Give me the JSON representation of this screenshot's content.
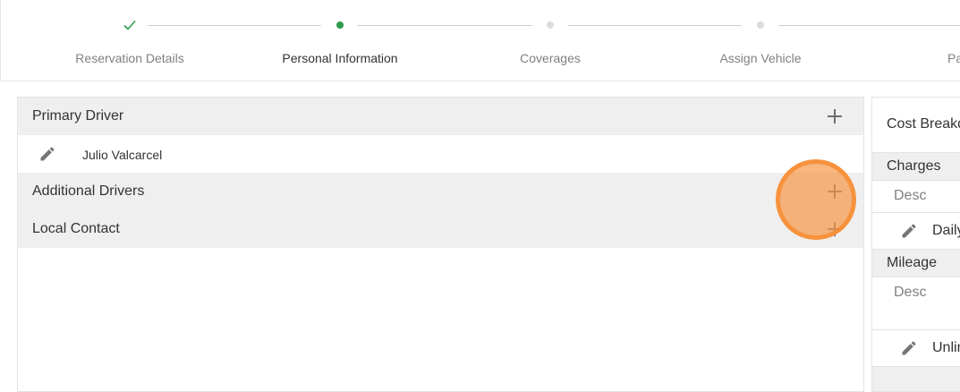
{
  "stepper": {
    "steps": [
      {
        "label": "Reservation Details",
        "state": "complete"
      },
      {
        "label": "Personal Information",
        "state": "active"
      },
      {
        "label": "Coverages",
        "state": "upcoming"
      },
      {
        "label": "Assign Vehicle",
        "state": "upcoming"
      },
      {
        "label": "Paym",
        "state": "upcoming"
      }
    ],
    "complete_color": "#2e9b4e"
  },
  "drivers": {
    "primary_driver_label": "Primary Driver",
    "primary_driver_name": "Julio Valcarcel",
    "additional_drivers_label": "Additional Drivers",
    "local_contact_label": "Local Contact"
  },
  "cost": {
    "title": "Cost Breakd",
    "charges_label": "Charges",
    "charges_desc": "Desc",
    "charges_row": "Daily",
    "mileage_label": "Mileage",
    "mileage_desc": "Desc",
    "mileage_row": "Unlin"
  },
  "icons": {
    "add": "plus-icon",
    "edit": "pencil-icon",
    "done": "check-icon"
  }
}
